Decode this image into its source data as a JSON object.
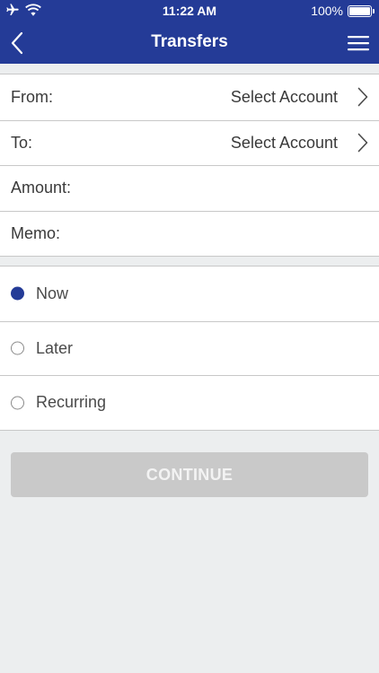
{
  "status_bar": {
    "time": "11:22 AM",
    "battery": "100%",
    "battery_level": 1.0,
    "icons": [
      "airplane-icon",
      "wifi-icon",
      "battery-icon"
    ]
  },
  "nav": {
    "title": "Transfers",
    "back_icon": "chevron-left-icon",
    "menu_icon": "hamburger-menu-icon"
  },
  "form": {
    "from_label": "From:",
    "from_value": "Select Account",
    "to_label": "To:",
    "to_value": "Select Account",
    "amount_label": "Amount:",
    "memo_label": "Memo:"
  },
  "timing": {
    "options": [
      {
        "label": "Now",
        "selected": true
      },
      {
        "label": "Later",
        "selected": false
      },
      {
        "label": "Recurring",
        "selected": false
      }
    ]
  },
  "actions": {
    "continue_label": "CONTINUE"
  },
  "colors": {
    "brand": "#243b97",
    "background": "#eceeef",
    "disabled_button": "#c9c9c9"
  }
}
